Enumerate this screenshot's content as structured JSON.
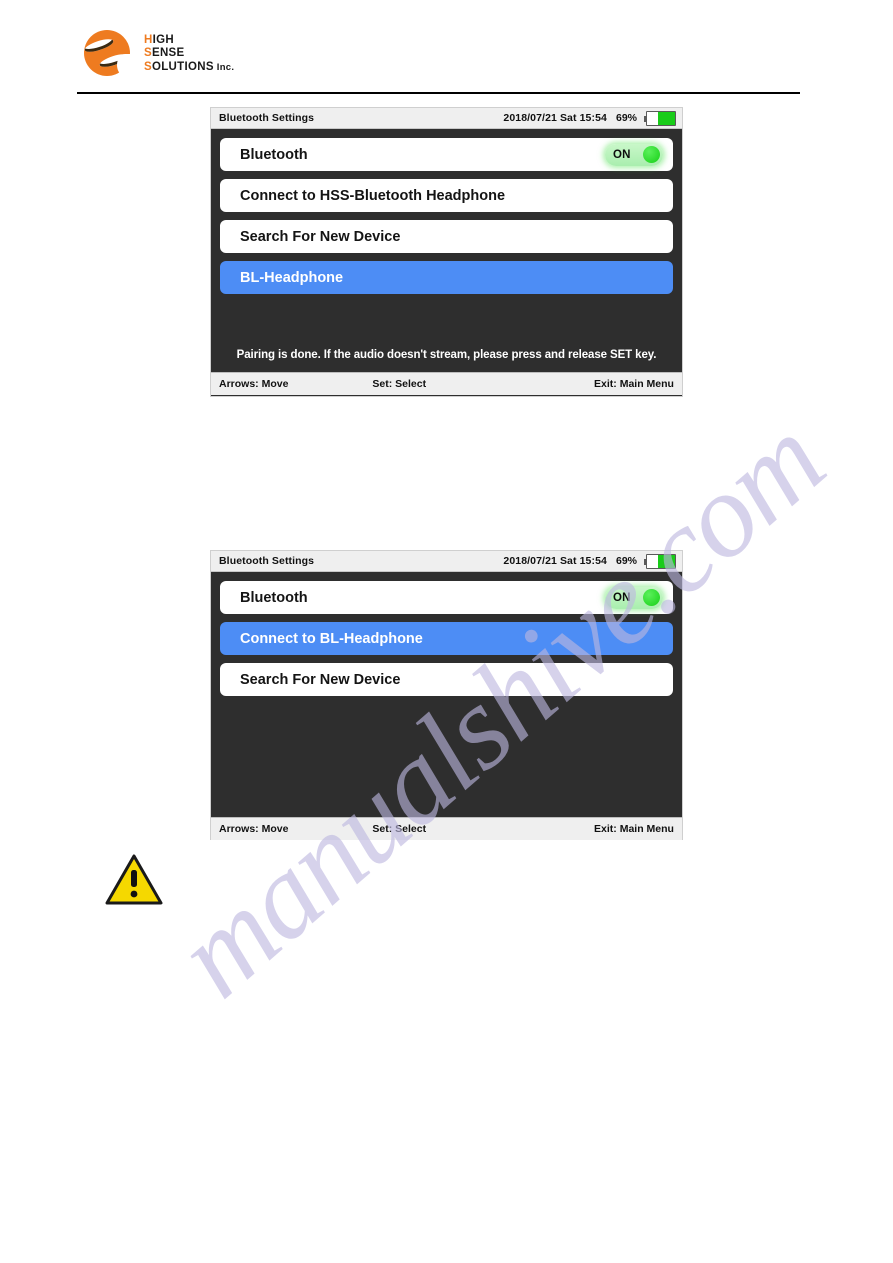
{
  "brand": {
    "logo_icon": "hss-sun-logo-icon",
    "line1_accent": "H",
    "line1_rest": "IGH",
    "line2_accent": "S",
    "line2_rest": "ENSE",
    "line3_accent": "S",
    "line3_rest": "OLUTIONS",
    "suffix": " Inc.",
    "accent_color": "#ee7b20"
  },
  "watermark": {
    "text": "manualshive.com",
    "color": "#bdb8e0"
  },
  "colors": {
    "screen_bg": "#2e2e2e",
    "row_bg": "#ffffff",
    "selected_row_bg": "#4d8df5",
    "toggle_green": "#19cc19",
    "warning_yellow": "#f5d800"
  },
  "screens": [
    {
      "id": "screen-1",
      "title": "Bluetooth Settings",
      "datetime": "2018/07/21 Sat 15:54",
      "battery_percent": "69%",
      "rows": [
        {
          "label": "Bluetooth",
          "selected": false,
          "toggle": "ON"
        },
        {
          "label": "Connect to HSS-Bluetooth Headphone",
          "selected": false
        },
        {
          "label": "Search For New Device",
          "selected": false
        },
        {
          "label": "BL-Headphone",
          "selected": true
        }
      ],
      "message": "Pairing is done. If the audio doesn't stream, please press and release SET key.",
      "footer": {
        "left": "Arrows: Move",
        "middle": "Set: Select",
        "right": "Exit: Main Menu"
      }
    },
    {
      "id": "screen-2",
      "title": "Bluetooth Settings",
      "datetime": "2018/07/21 Sat 15:54",
      "battery_percent": "69%",
      "rows": [
        {
          "label": "Bluetooth",
          "selected": false,
          "toggle": "ON"
        },
        {
          "label": "Connect to BL-Headphone",
          "selected": true
        },
        {
          "label": "Search For New Device",
          "selected": false
        }
      ],
      "message": "",
      "footer": {
        "left": "Arrows: Move",
        "middle": "Set: Select",
        "right": "Exit: Main Menu"
      }
    }
  ],
  "warning": {
    "icon": "warning-triangle-icon",
    "symbol": "!"
  }
}
